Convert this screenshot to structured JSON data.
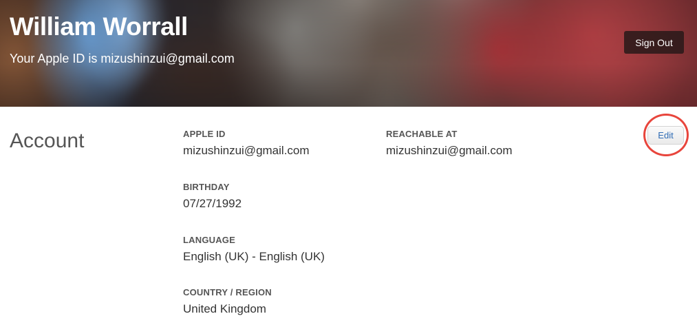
{
  "header": {
    "name": "William Worrall",
    "apple_id_line": "Your Apple ID is mizushinzui@gmail.com",
    "sign_out_label": "Sign Out"
  },
  "account": {
    "title": "Account",
    "edit_label": "Edit",
    "fields": {
      "apple_id": {
        "label": "APPLE ID",
        "value": "mizushinzui@gmail.com"
      },
      "reachable_at": {
        "label": "REACHABLE AT",
        "value": "mizushinzui@gmail.com"
      },
      "birthday": {
        "label": "BIRTHDAY",
        "value": "07/27/1992"
      },
      "language": {
        "label": "LANGUAGE",
        "value": "English (UK) - English (UK)"
      },
      "country_region": {
        "label": "COUNTRY / REGION",
        "value": "United Kingdom"
      }
    }
  },
  "colors": {
    "text_primary": "#333333",
    "text_secondary": "#555555",
    "link_blue": "#2f6cb5",
    "highlight_red": "#e8453c"
  }
}
